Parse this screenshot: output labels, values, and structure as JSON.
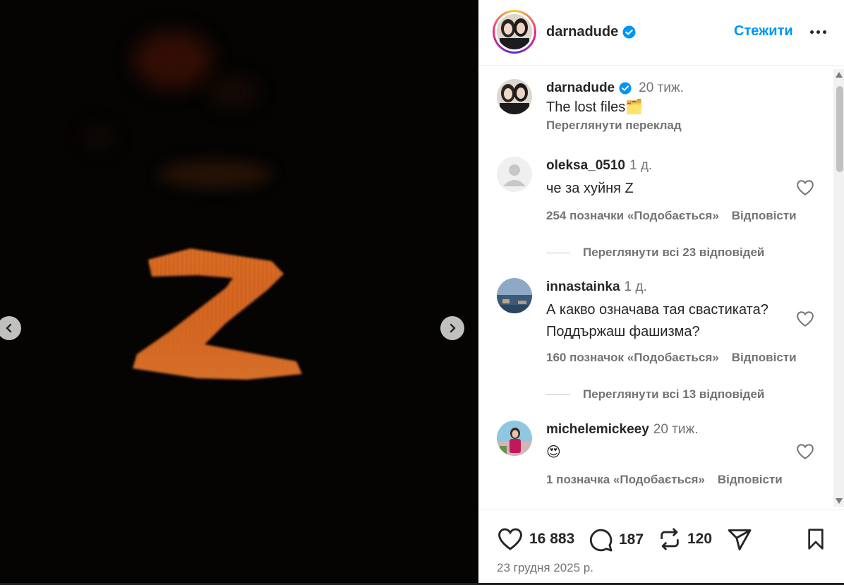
{
  "post": {
    "username": "darnadude",
    "follow_label": "Стежити",
    "caption_time": "20 тиж.",
    "caption_text": "The lost files",
    "caption_emoji": "🗂️",
    "translate_label": "Переглянути переклад"
  },
  "comments": [
    {
      "username": "oleksa_0510",
      "time": "1 д.",
      "text": "че за хуйня Z",
      "likes": "254 позначки «Подобається»",
      "reply_label": "Відповісти",
      "view_replies": "Переглянути всі 23 відповідей"
    },
    {
      "username": "innastainka",
      "time": "1 д.",
      "text": "А какво означава тая свастиката? Поддържаш фашизма?",
      "likes": "160 позначок «Подобається»",
      "reply_label": "Відповісти",
      "view_replies": "Переглянути всі 13 відповідей"
    },
    {
      "username": "michelemickeey",
      "time": "20 тиж.",
      "text": "😍",
      "likes": "1 позначка «Подобається»",
      "reply_label": "Відповісти"
    }
  ],
  "actions": {
    "likes": "16 883",
    "comments": "187",
    "reposts": "120"
  },
  "date": "23 грудня 2025 р.",
  "colors": {
    "accent": "#0095f6",
    "verified": "#0095f6",
    "muted": "#737373",
    "fire": "#e0621b"
  }
}
